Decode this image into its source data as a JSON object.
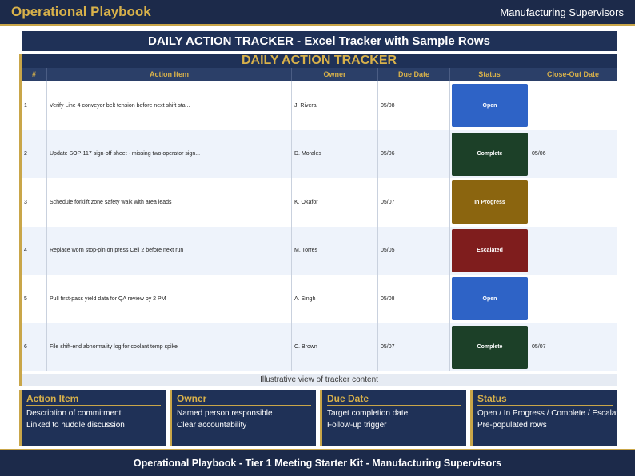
{
  "header": {
    "brand": "Operational Playbook",
    "audience": "Manufacturing Supervisors"
  },
  "slide_title": "DAILY ACTION TRACKER  -  Excel Tracker with Sample Rows",
  "tracker": {
    "title": "DAILY ACTION TRACKER",
    "columns": [
      "#",
      "Action Item",
      "Owner",
      "Due Date",
      "Status",
      "Close-Out Date"
    ],
    "rows": [
      {
        "num": "1",
        "action": "Verify Line 4 conveyor belt tension before next shift sta...",
        "owner": "J. Rivera",
        "due": "05/08",
        "status": "Open",
        "status_color": "#2e63c6",
        "closeout": ""
      },
      {
        "num": "2",
        "action": "Update SOP-117 sign-off sheet - missing two operator sign...",
        "owner": "D. Morales",
        "due": "05/06",
        "status": "Complete",
        "status_color": "#1c4028",
        "closeout": "05/06"
      },
      {
        "num": "3",
        "action": "Schedule forklift zone safety walk with area leads",
        "owner": "K. Okafor",
        "due": "05/07",
        "status": "In Progress",
        "status_color": "#8b650f",
        "closeout": ""
      },
      {
        "num": "4",
        "action": "Replace worn stop-pin on press Cell 2 before next run",
        "owner": "M. Torres",
        "due": "05/05",
        "status": "Escalated",
        "status_color": "#7f1d1d",
        "closeout": ""
      },
      {
        "num": "5",
        "action": "Pull first-pass yield data for QA review by 2 PM",
        "owner": "A. Singh",
        "due": "05/08",
        "status": "Open",
        "status_color": "#2e63c6",
        "closeout": ""
      },
      {
        "num": "6",
        "action": "File shift-end abnormality log for coolant temp spike",
        "owner": "C. Brown",
        "due": "05/07",
        "status": "Complete",
        "status_color": "#1c4028",
        "closeout": "05/07"
      }
    ],
    "caption": "Illustrative view of tracker content"
  },
  "cards": [
    {
      "title": "Action Item",
      "lines": [
        "Description of commitment",
        "Linked to huddle discussion"
      ]
    },
    {
      "title": "Owner",
      "lines": [
        "Named person responsible",
        "Clear accountability"
      ]
    },
    {
      "title": "Due Date",
      "lines": [
        "Target completion date",
        "Follow-up trigger"
      ]
    },
    {
      "title": "Status",
      "lines": [
        "Open / In Progress / Complete / Escalated",
        "Pre-populated rows"
      ]
    }
  ],
  "footer": "Operational Playbook  -  Tier 1 Meeting Starter Kit  -  Manufacturing Supervisors"
}
